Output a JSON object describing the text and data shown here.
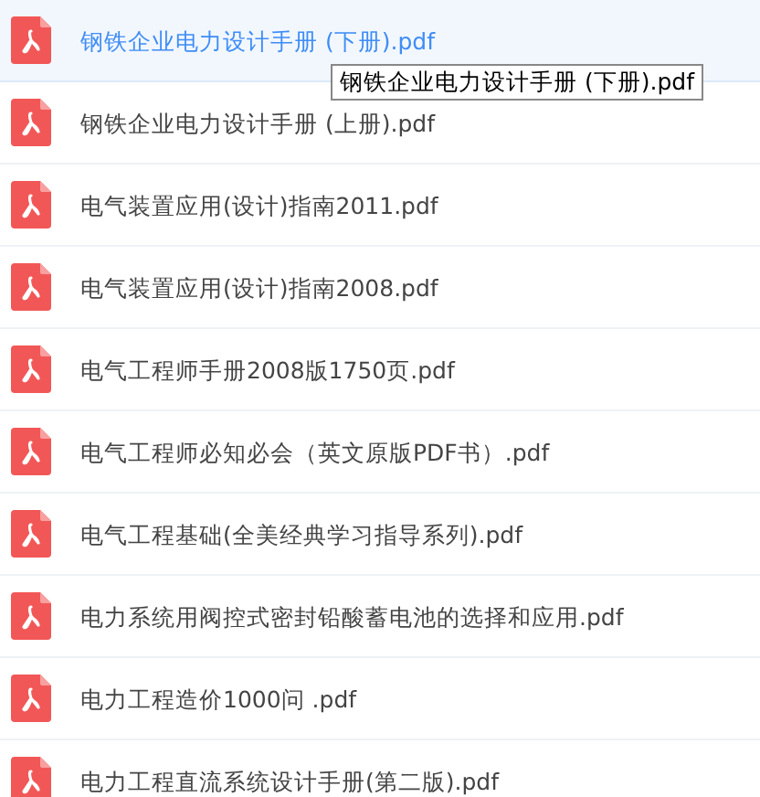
{
  "files": [
    {
      "name": "钢铁企业电力设计手册 (下册).pdf",
      "selected": true
    },
    {
      "name": "钢铁企业电力设计手册 (上册).pdf",
      "selected": false
    },
    {
      "name": "电气装置应用(设计)指南2011.pdf",
      "selected": false
    },
    {
      "name": "电气装置应用(设计)指南2008.pdf",
      "selected": false
    },
    {
      "name": "电气工程师手册2008版1750页.pdf",
      "selected": false
    },
    {
      "name": "电气工程师必知必会（英文原版PDF书）.pdf",
      "selected": false
    },
    {
      "name": "电气工程基础(全美经典学习指导系列).pdf",
      "selected": false
    },
    {
      "name": "电力系统用阀控式密封铅酸蓄电池的选择和应用.pdf",
      "selected": false
    },
    {
      "name": "电力工程造价1000问 .pdf",
      "selected": false
    },
    {
      "name": "电力工程直流系统设计手册(第二版).pdf",
      "selected": false
    }
  ],
  "tooltip": {
    "text": "钢铁企业电力设计手册 (下册).pdf"
  }
}
